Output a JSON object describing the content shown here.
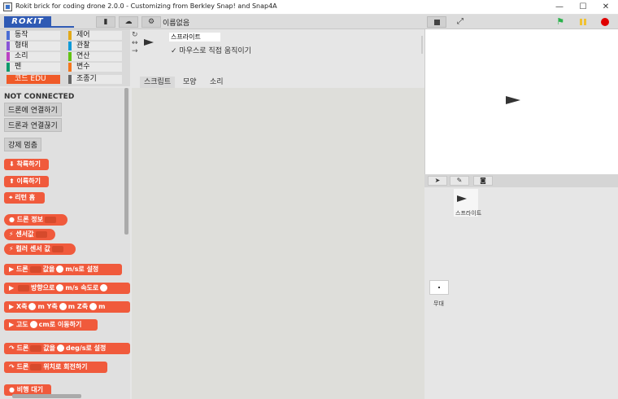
{
  "window": {
    "title": "Rokit brick for coding drone 2.0.0 - Customizing from Berkley Snap! and Snap4A",
    "min": "—",
    "max": "☐",
    "close": "✕"
  },
  "toolbar": {
    "logo": "ROKIT",
    "project_name": "이름없음"
  },
  "categories": [
    {
      "label": "동작",
      "color": "#4a6cd4"
    },
    {
      "label": "제어",
      "color": "#e1a91a"
    },
    {
      "label": "형태",
      "color": "#8a55d7"
    },
    {
      "label": "관찰",
      "color": "#0e9ad8"
    },
    {
      "label": "소리",
      "color": "#bb42c3"
    },
    {
      "label": "연산",
      "color": "#62c213"
    },
    {
      "label": "펜",
      "color": "#0e9a6c"
    },
    {
      "label": "변수",
      "color": "#f3761d"
    },
    {
      "label": "코드 EDU",
      "color": "#f05a28"
    },
    {
      "label": "조종기",
      "color": "#666666"
    }
  ],
  "palette": {
    "status": "NOT CONNECTED",
    "connect": "드론에 연결하기",
    "disconnect": "드론과 연결끊기",
    "force_land": "강제 멈춤",
    "blocks": {
      "takeoff": "착륙하기",
      "land": "이륙하기",
      "return_home": "리턴 홈",
      "drone_info": "드론 정보",
      "sensor_value": "센서값",
      "color_sensor": "컬러 센서 값",
      "set_speed_a": "드론",
      "set_speed_b": "값을",
      "set_speed_c": "m/s로 설정",
      "dir_speed_a": "방향으로",
      "dir_speed_b": "m/s 속도로",
      "xyz_x": "X축",
      "xyz_m1": "m",
      "xyz_y": "Y축",
      "xyz_m2": "m",
      "xyz_z": "Z축",
      "xyz_m3": "m",
      "alt_a": "고도",
      "alt_b": "cm로 이동하기",
      "rot_a": "드론",
      "rot_b": "값을",
      "rot_c": "deg/s로 설정",
      "turn_a": "드론",
      "turn_b": "위치로 회전하기",
      "flight_wait": "비행 대기"
    }
  },
  "sprite": {
    "name": "스프라이트",
    "drag_label": "마우스로 직접 움직이기",
    "check": "✓"
  },
  "tabs": [
    "스크립트",
    "모양",
    "소리"
  ],
  "corral": {
    "sprite_label": "스프라이트",
    "stage_label": "무대"
  }
}
